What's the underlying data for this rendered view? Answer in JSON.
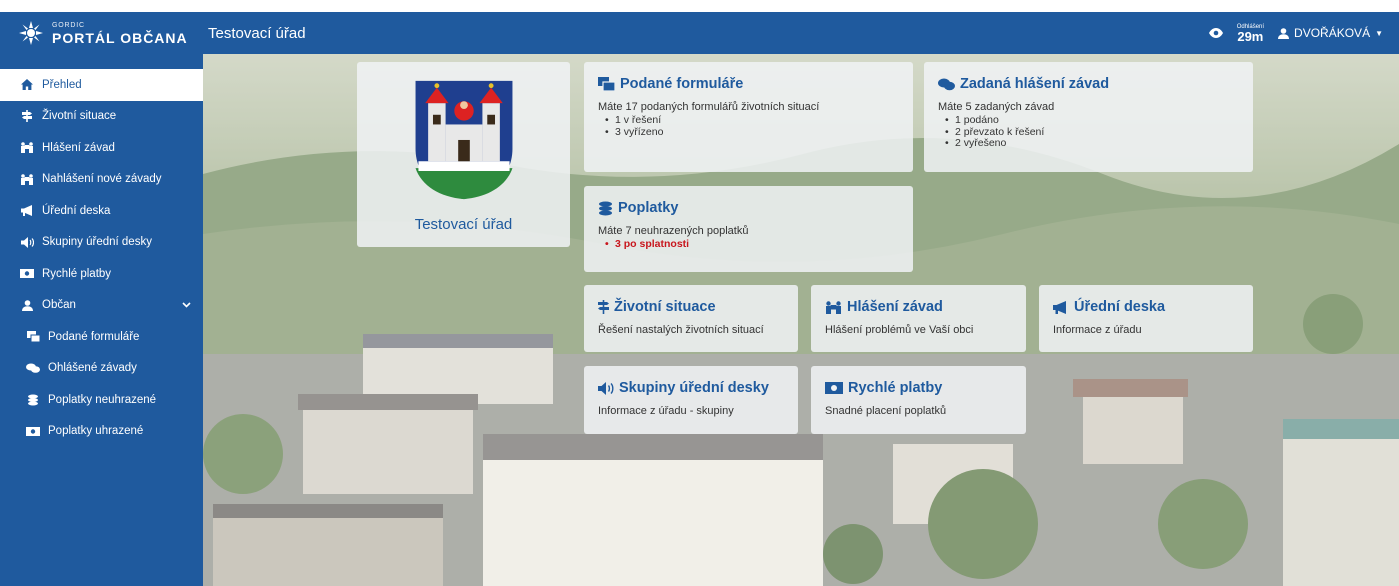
{
  "header": {
    "logo_small": "GORDIC",
    "logo_big": "PORTÁL OBČANA",
    "office": "Testovací úřad",
    "timer_label": "Odhlášení",
    "timer_value": "29m",
    "user": "DVOŘÁKOVÁ"
  },
  "sidebar": {
    "items": [
      {
        "label": "Přehled"
      },
      {
        "label": "Životní situace"
      },
      {
        "label": "Hlášení závad"
      },
      {
        "label": "Nahlášení nové závady"
      },
      {
        "label": "Úřední deska"
      },
      {
        "label": "Skupiny úřední desky"
      },
      {
        "label": "Rychlé platby"
      },
      {
        "label": "Občan"
      },
      {
        "label": "Podané formuláře"
      },
      {
        "label": "Ohlášené závady"
      },
      {
        "label": "Poplatky neuhrazené"
      },
      {
        "label": "Poplatky uhrazené"
      }
    ]
  },
  "crest": {
    "name": "Testovací úřad"
  },
  "forms": {
    "title": "Podané formuláře",
    "summary": "Máte 17 podaných formulářů životních situací",
    "items": [
      "1 v řešení",
      "3 vyřízeno"
    ]
  },
  "defects": {
    "title": "Zadaná hlášení závad",
    "summary": "Máte 5 zadaných závad",
    "items": [
      "1 podáno",
      "2 převzato k řešení",
      "2 vyřešeno"
    ]
  },
  "fees": {
    "title": "Poplatky",
    "summary": "Máte 7 neuhrazených poplatků",
    "items": [
      "3 po splatnosti"
    ]
  },
  "tiles": {
    "life": {
      "title": "Životní situace",
      "desc": "Řešení nastalých životních situací"
    },
    "report": {
      "title": "Hlášení závad",
      "desc": "Hlášení problémů ve Vaší obci"
    },
    "board": {
      "title": "Úřední deska",
      "desc": "Informace z úřadu"
    },
    "groups": {
      "title": "Skupiny úřední desky",
      "desc": "Informace z úřadu - skupiny"
    },
    "pay": {
      "title": "Rychlé platby",
      "desc": "Snadné placení poplatků"
    }
  },
  "colors": {
    "primary": "#1f5a9e",
    "overdue": "#c8161d"
  }
}
